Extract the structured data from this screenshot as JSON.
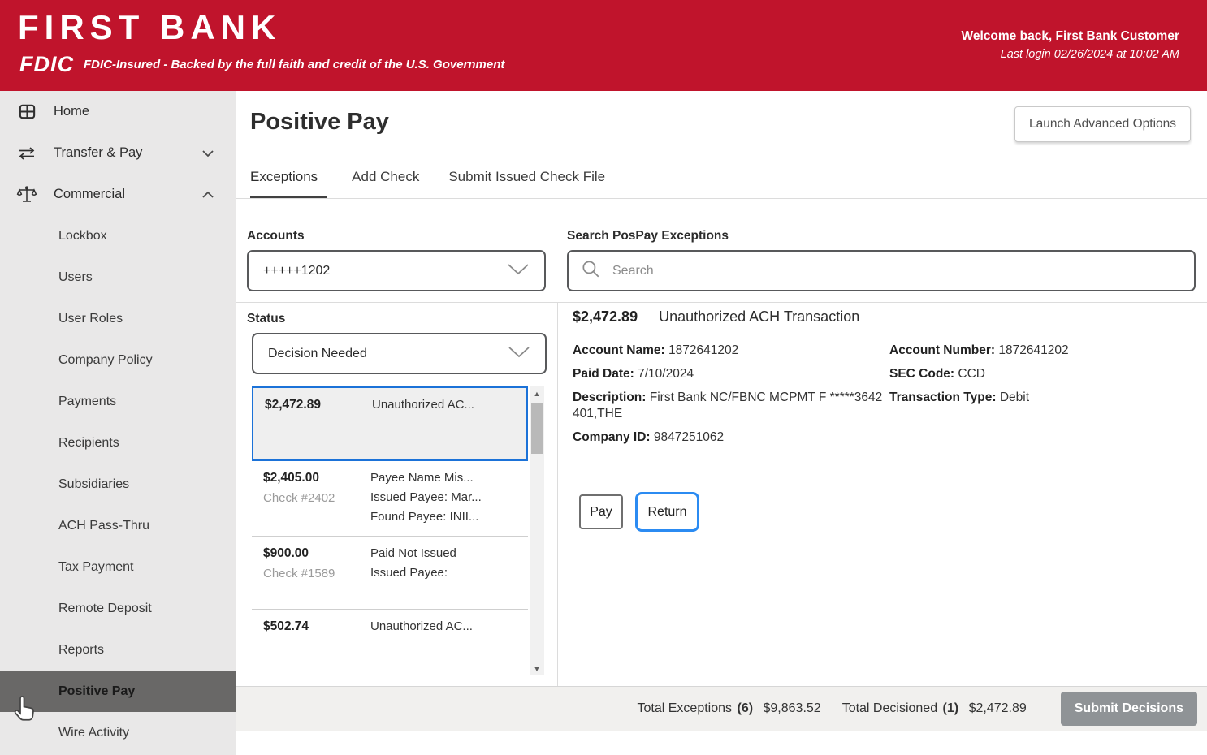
{
  "header": {
    "bank_name": "FIRST BANK",
    "fdic_logo": "FDIC",
    "fdic_text": "FDIC-Insured - Backed by the full faith and credit of the U.S. Government",
    "welcome": "Welcome back, First Bank Customer",
    "last_login": "Last login 02/26/2024 at 10:02 AM"
  },
  "sidebar": {
    "items": [
      {
        "label": "Home",
        "icon": "home-grid-icon"
      },
      {
        "label": "Transfer & Pay",
        "icon": "transfer-arrows-icon",
        "chevron": "down"
      },
      {
        "label": "Commercial",
        "icon": "scales-icon",
        "chevron": "up"
      }
    ],
    "sub_items": [
      "Lockbox",
      "Users",
      "User Roles",
      "Company Policy",
      "Payments",
      "Recipients",
      "Subsidiaries",
      "ACH Pass-Thru",
      "Tax Payment",
      "Remote Deposit",
      "Reports",
      "Positive Pay",
      "Wire Activity"
    ],
    "active_item": "Positive Pay"
  },
  "main": {
    "title": "Positive Pay",
    "advanced_button": "Launch Advanced Options",
    "tabs": [
      {
        "label": "Exceptions",
        "active": true
      },
      {
        "label": "Add Check",
        "active": false
      },
      {
        "label": "Submit Issued Check File",
        "active": false
      }
    ],
    "accounts": {
      "label": "Accounts",
      "selected": "+++++1202"
    },
    "search": {
      "label": "Search PosPay Exceptions",
      "placeholder": "Search"
    },
    "status": {
      "label": "Status",
      "selected": "Decision Needed"
    },
    "exceptions": [
      {
        "amount": "$2,472.89",
        "line1": "Unauthorized AC...",
        "selected": true
      },
      {
        "amount": "$2,405.00",
        "check": "Check #2402",
        "line1": "Payee Name Mis...",
        "line2": "Issued Payee: Mar...",
        "line3": "Found Payee: INII..."
      },
      {
        "amount": "$900.00",
        "check": "Check #1589",
        "line1": "Paid Not Issued",
        "line2": "Issued Payee:"
      },
      {
        "amount": "$502.74",
        "line1": "Unauthorized AC..."
      }
    ],
    "detail": {
      "amount": "$2,472.89",
      "type": "Unauthorized ACH Transaction",
      "account_name_label": "Account Name:",
      "account_name": "1872641202",
      "paid_date_label": "Paid Date:",
      "paid_date": "7/10/2024",
      "description_label": "Description:",
      "description": "First Bank NC/FBNC MCPMT F *****3642 401,THE",
      "company_id_label": "Company ID:",
      "company_id": "9847251062",
      "account_number_label": "Account Number:",
      "account_number": "1872641202",
      "sec_code_label": "SEC Code:",
      "sec_code": "CCD",
      "transaction_type_label": "Transaction Type:",
      "transaction_type": "Debit",
      "pay_button": "Pay",
      "return_button": "Return"
    },
    "footer": {
      "total_exceptions_label": "Total Exceptions",
      "total_exceptions_count": "(6)",
      "total_exceptions_amount": "$9,863.52",
      "total_decisioned_label": "Total Decisioned",
      "total_decisioned_count": "(1)",
      "total_decisioned_amount": "$2,472.89",
      "submit_button": "Submit Decisions"
    }
  },
  "colors": {
    "header_red": "#c0142c",
    "sidebar_bg": "#e9e8e8",
    "active_item_bg": "#696867",
    "selected_border_blue": "#1b72d8",
    "return_border_blue": "#2b8bf2",
    "footer_bg": "#f1f0ee",
    "submit_btn_bg": "#8f9396"
  }
}
